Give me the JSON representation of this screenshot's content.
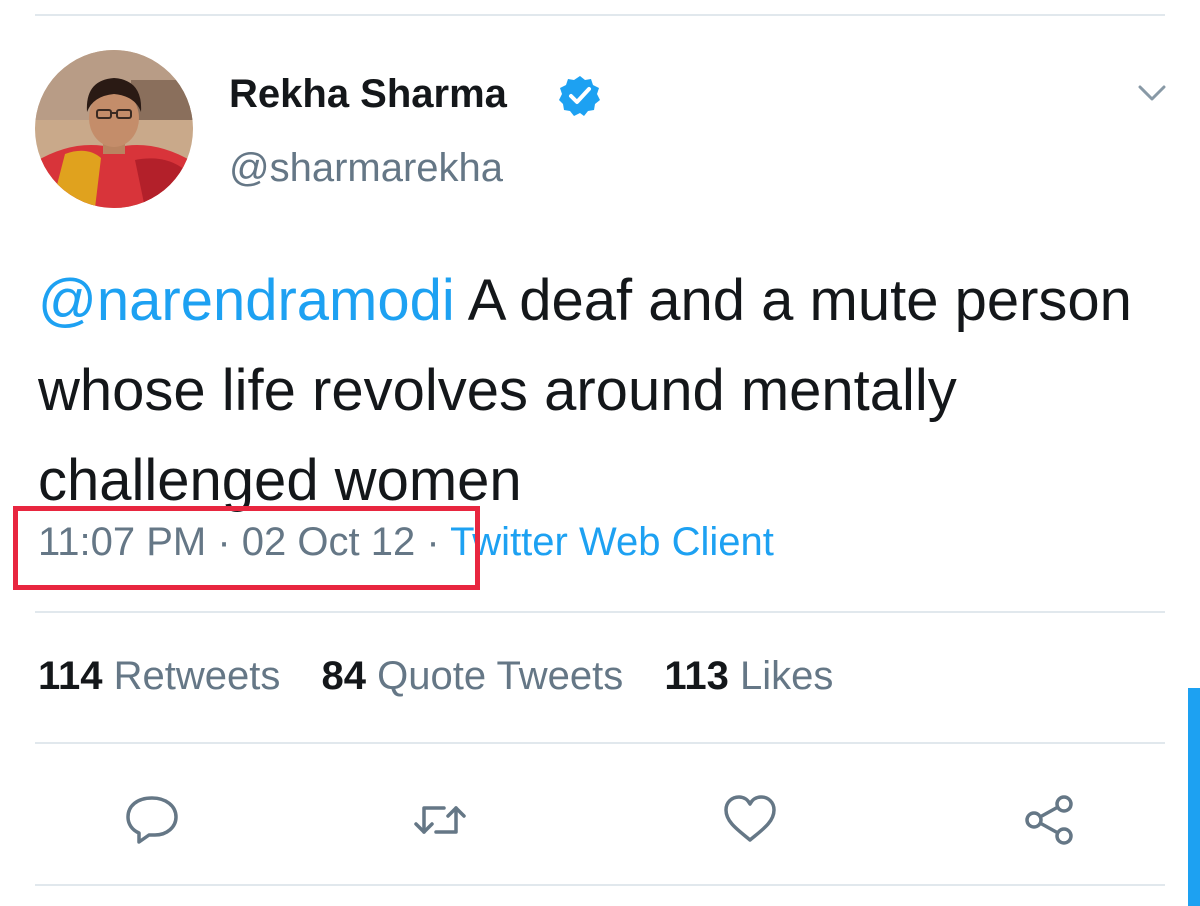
{
  "author": {
    "display_name": "Rekha Sharma",
    "handle": "@sharmarekha",
    "verified": true
  },
  "tweet": {
    "mention": "@narendramodi",
    "text": "A deaf and a mute person whose life revolves around mentally challenged women",
    "timestamp": "11:07 PM · 02 Oct 12",
    "separator": " · ",
    "source": "Twitter Web Client"
  },
  "stats": {
    "retweets": {
      "count": "114",
      "label": "Retweets"
    },
    "quote_tweets": {
      "count": "84",
      "label": "Quote Tweets"
    },
    "likes": {
      "count": "113",
      "label": "Likes"
    }
  },
  "icons": {
    "reply": "reply-icon",
    "retweet": "retweet-icon",
    "like": "heart-icon",
    "share": "share-icon",
    "more": "chevron-down-icon",
    "verified": "verified-badge-icon"
  },
  "colors": {
    "accent": "#1da1f2",
    "highlight_box": "#e8263f",
    "secondary_text": "#657786",
    "primary_text": "#14171a"
  }
}
